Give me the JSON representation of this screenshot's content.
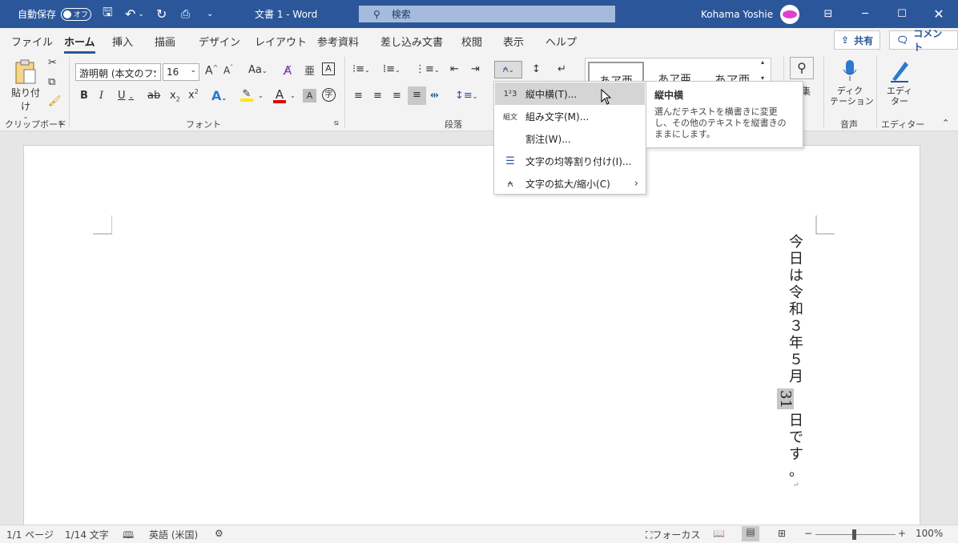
{
  "titlebar": {
    "autosave_label": "自動保存",
    "autosave_state": "オフ",
    "document_title": "文書 1  -  Word",
    "search_placeholder": "検索",
    "user_name": "Kohama Yoshie"
  },
  "tabs": [
    "ファイル",
    "ホーム",
    "挿入",
    "描画",
    "デザイン",
    "レイアウト",
    "参考資料",
    "差し込み文書",
    "校閲",
    "表示",
    "ヘルプ"
  ],
  "active_tab": "ホーム",
  "share_label": "共有",
  "comment_label": "コメント",
  "ribbon": {
    "clipboard": {
      "paste_label": "貼り付け",
      "group_label": "クリップボード"
    },
    "font": {
      "font_name": "游明朝 (本文のフ:",
      "font_size": "16",
      "group_label": "フォント"
    },
    "paragraph": {
      "group_label": "段落"
    },
    "styles": {
      "items": [
        "あア亜",
        "あア亜",
        "あア亜"
      ]
    },
    "editing": {
      "label": "集"
    },
    "voice": {
      "dictate_label": "ディク\nテーション",
      "group_label": "音声"
    },
    "editor": {
      "editor_label": "エディ\nター",
      "group_label": "エディター"
    }
  },
  "dropdown": {
    "items": [
      {
        "label": "縦中横(T)...",
        "icon": "tate-chu-yoko-icon"
      },
      {
        "label": "組み文字(M)...",
        "icon": "combine-characters-icon"
      },
      {
        "label": "割注(W)...",
        "icon": ""
      },
      {
        "label": "文字の均等割り付け(I)...",
        "icon": "distribute-text-icon"
      },
      {
        "label": "文字の拡大/縮小(C)",
        "icon": "character-scale-icon"
      }
    ]
  },
  "tooltip": {
    "title": "縦中横",
    "body": "選んだテキストを横書きに変更し、その他のテキストを縦書きのままにします。"
  },
  "document": {
    "vertical_text": [
      "今",
      "日",
      "は",
      "令",
      "和",
      "３",
      "年",
      "５",
      "月",
      "31",
      "日",
      "で",
      "す",
      "。"
    ],
    "highlighted_index": 9,
    "paragraph_mark": "↵"
  },
  "statusbar": {
    "page": "1/1 ページ",
    "words": "1/14 文字",
    "language": "英語 (米国)",
    "focus": "フォーカス",
    "zoom": "100%"
  },
  "colors": {
    "brand": "#2b579a",
    "highlight_yellow": "#ffe600",
    "font_red": "#e00000"
  }
}
